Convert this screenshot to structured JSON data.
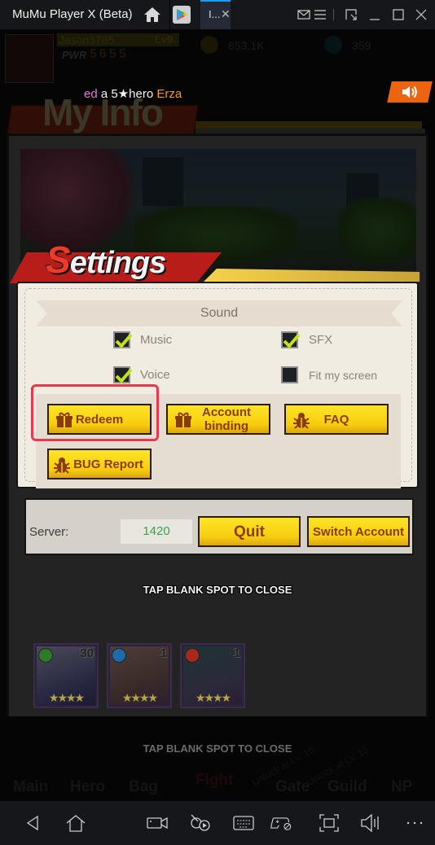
{
  "window": {
    "app_title": "MuMu Player X  (Beta)",
    "active_tab_label": "I...",
    "icons": [
      "home-icon",
      "play-store-icon",
      "close-tab-icon",
      "mail-icon",
      "menu-icon",
      "pin-icon",
      "minimize-icon",
      "maximize-icon",
      "close-icon"
    ]
  },
  "hud": {
    "player_name": "Jason3785",
    "level": "Lv9",
    "power_label": "PWR",
    "power_value": "5655",
    "gold": "653.1K",
    "gems": "359"
  },
  "ticker": {
    "prefix": "ed",
    "middle": " a 5★hero ",
    "hero": "Erza"
  },
  "background_title": "My Info",
  "settings": {
    "title_initial": "S",
    "title_rest": "ettings",
    "sound_header": "Sound",
    "options": [
      {
        "label": "Music",
        "checked": true
      },
      {
        "label": "SFX",
        "checked": true
      },
      {
        "label": "Voice",
        "checked": true
      },
      {
        "label": "Fit my screen",
        "checked": false
      }
    ],
    "buttons": {
      "redeem": "Redeem",
      "account_binding_line1": "Account",
      "account_binding_line2": "binding",
      "faq": "FAQ",
      "bug_report": "BUG Report"
    },
    "server_label": "Server:",
    "server_value": "1420",
    "quit": "Quit",
    "switch_account": "Switch Account"
  },
  "tap_to_close": "TAP BLANK SPOT TO CLOSE",
  "heroes": [
    {
      "level": "30",
      "stars": "★★★★",
      "element_color": "#2d7a2a"
    },
    {
      "level": "1",
      "stars": "★★★★",
      "element_color": "#1f6aa8"
    },
    {
      "level": "1",
      "stars": "★★★★",
      "element_color": "#a8281f"
    }
  ],
  "bottom_nav": {
    "items": [
      "Main",
      "Hero",
      "Bag",
      "Fight",
      "Gate",
      "Guild",
      "NP"
    ],
    "unlock_text": "Unlock at Lv. 15"
  },
  "emulator_toolbar": {
    "icons": [
      "back-icon",
      "home-icon",
      "camera-record-icon",
      "macro-icon",
      "keyboard-icon",
      "gamepad-icon",
      "screenshot-icon",
      "volume-icon",
      "more-icon"
    ]
  },
  "colors": {
    "accent_tab": "#1e9cf0",
    "button_yellow": "#f8cd0d",
    "button_text": "#8a3c07",
    "highlight": "#e8384d",
    "server_value": "#2fa84d",
    "sound_orange": "#ec6410"
  }
}
